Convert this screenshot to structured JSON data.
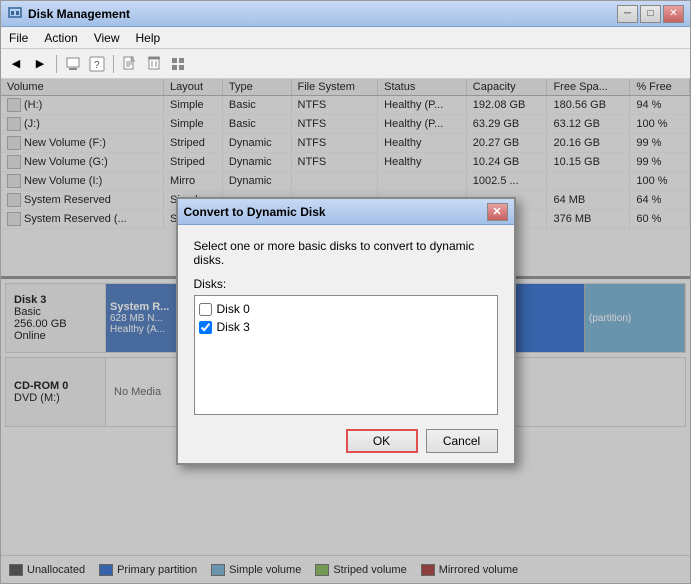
{
  "window": {
    "title": "Disk Management",
    "controls": {
      "minimize": "─",
      "maximize": "□",
      "close": "✕"
    }
  },
  "menu": {
    "items": [
      "File",
      "Action",
      "View",
      "Help"
    ]
  },
  "toolbar": {
    "buttons": [
      "◀",
      "▶",
      "⬛",
      "📋",
      "🖊"
    ]
  },
  "table": {
    "columns": [
      "Volume",
      "Layout",
      "Type",
      "File System",
      "Status",
      "Capacity",
      "Free Spa...",
      "% Free"
    ],
    "rows": [
      {
        "volume": "(H:)",
        "layout": "Simple",
        "type": "Basic",
        "fs": "NTFS",
        "status": "Healthy (P...",
        "capacity": "192.08 GB",
        "free": "180.56 GB",
        "pct": "94 %"
      },
      {
        "volume": "(J:)",
        "layout": "Simple",
        "type": "Basic",
        "fs": "NTFS",
        "status": "Healthy (P...",
        "capacity": "63.29 GB",
        "free": "63.12 GB",
        "pct": "100 %"
      },
      {
        "volume": "New Volume (F:)",
        "layout": "Striped",
        "type": "Dynamic",
        "fs": "NTFS",
        "status": "Healthy",
        "capacity": "20.27 GB",
        "free": "20.16 GB",
        "pct": "99 %"
      },
      {
        "volume": "New Volume (G:)",
        "layout": "Striped",
        "type": "Dynamic",
        "fs": "NTFS",
        "status": "Healthy",
        "capacity": "10.24 GB",
        "free": "10.15 GB",
        "pct": "99 %"
      },
      {
        "volume": "New Volume (I:)",
        "layout": "Mirro",
        "type": "Dynamic",
        "fs": "",
        "status": "",
        "capacity": "1002.5 ...",
        "free": "",
        "pct": "100 %"
      },
      {
        "volume": "System Reserved",
        "layout": "Simpl",
        "type": "",
        "fs": "",
        "status": "",
        "capacity": "",
        "free": "64 MB",
        "pct": "64 %"
      },
      {
        "volume": "System Reserved (...",
        "layout": "Simpl",
        "type": "",
        "fs": "",
        "status": "",
        "capacity": "",
        "free": "376 MB",
        "pct": "60 %"
      }
    ]
  },
  "disk_view": {
    "disks": [
      {
        "name": "Disk 3",
        "type": "Basic",
        "size": "256.00 GB",
        "status": "Online",
        "partitions": [
          {
            "name": "System R...",
            "detail": "628 MB N...",
            "style": "system-reserved"
          },
          {
            "name": "",
            "detail": "Healthy (A...",
            "style": "primary-blue"
          },
          {
            "name": "(partition)",
            "detail": "",
            "style": "striped"
          }
        ]
      },
      {
        "name": "CD-ROM 0",
        "type": "DVD (M:)",
        "size": "",
        "status": "No Media",
        "partitions": []
      }
    ]
  },
  "legend": {
    "items": [
      {
        "label": "Unallocated",
        "color": "#444444"
      },
      {
        "label": "Primary partition",
        "color": "#2563c9"
      },
      {
        "label": "Simple volume",
        "color": "#6da8cc"
      },
      {
        "label": "Striped volume",
        "color": "#7ab050"
      },
      {
        "label": "Mirrored volume",
        "color": "#a03030"
      }
    ]
  },
  "dialog": {
    "title": "Convert to Dynamic Disk",
    "description": "Select one or more basic disks to convert to dynamic disks.",
    "disks_label": "Disks:",
    "disks": [
      {
        "label": "Disk 0",
        "checked": false
      },
      {
        "label": "Disk 3",
        "checked": true
      }
    ],
    "ok_label": "OK",
    "cancel_label": "Cancel"
  }
}
